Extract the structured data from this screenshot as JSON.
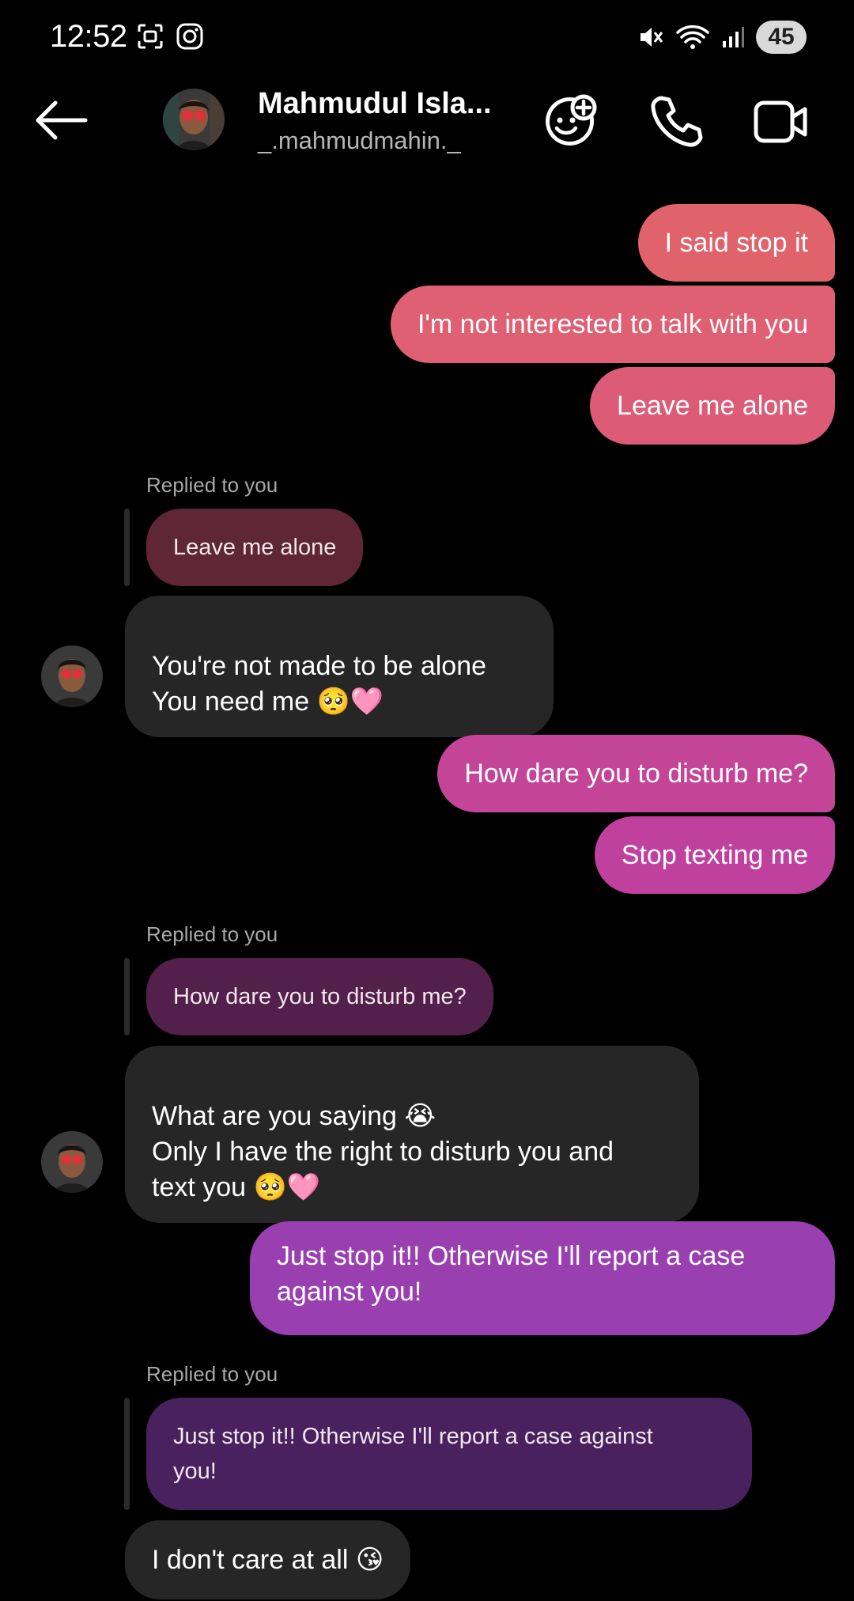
{
  "status_bar": {
    "time": "12:52",
    "battery": "45",
    "icons": [
      "screenshot-icon",
      "instagram-icon",
      "mute-icon",
      "wifi-icon",
      "signal-icon"
    ]
  },
  "header": {
    "name": "Mahmudul Isla...",
    "username": "_.mahmudmahin._",
    "icons": [
      "back-arrow-icon",
      "avatar",
      "add-effect-icon",
      "phone-icon",
      "video-icon"
    ]
  },
  "messages": {
    "m1": "I said stop it",
    "m2": "I'm not interested to talk with you",
    "m3": "Leave me alone",
    "r1_label": "Replied to you",
    "r1_quote": "Leave me alone",
    "m4": "You're not made to be alone\nYou need me 🥺🩷",
    "m5": "How dare you to disturb me?",
    "m6": "Stop texting me",
    "r2_label": "Replied to you",
    "r2_quote": "How dare you to disturb me?",
    "m7": "What are you saying 😭\nOnly I have the right to disturb you and\ntext you 🥺🩷",
    "m8": "Just stop it!! Otherwise I'll report a case\nagainst you!",
    "r3_label": "Replied to you",
    "r3_quote": "Just stop it!! Otherwise I'll report a case against\nyou!",
    "m9": "I don't care at all 😘"
  },
  "colors": {
    "background": "#000000",
    "incoming_bubble": "#262626",
    "outgoing_red": "#e2606c",
    "outgoing_pink": "#c23f9a",
    "outgoing_purple": "#9c3fb2"
  }
}
